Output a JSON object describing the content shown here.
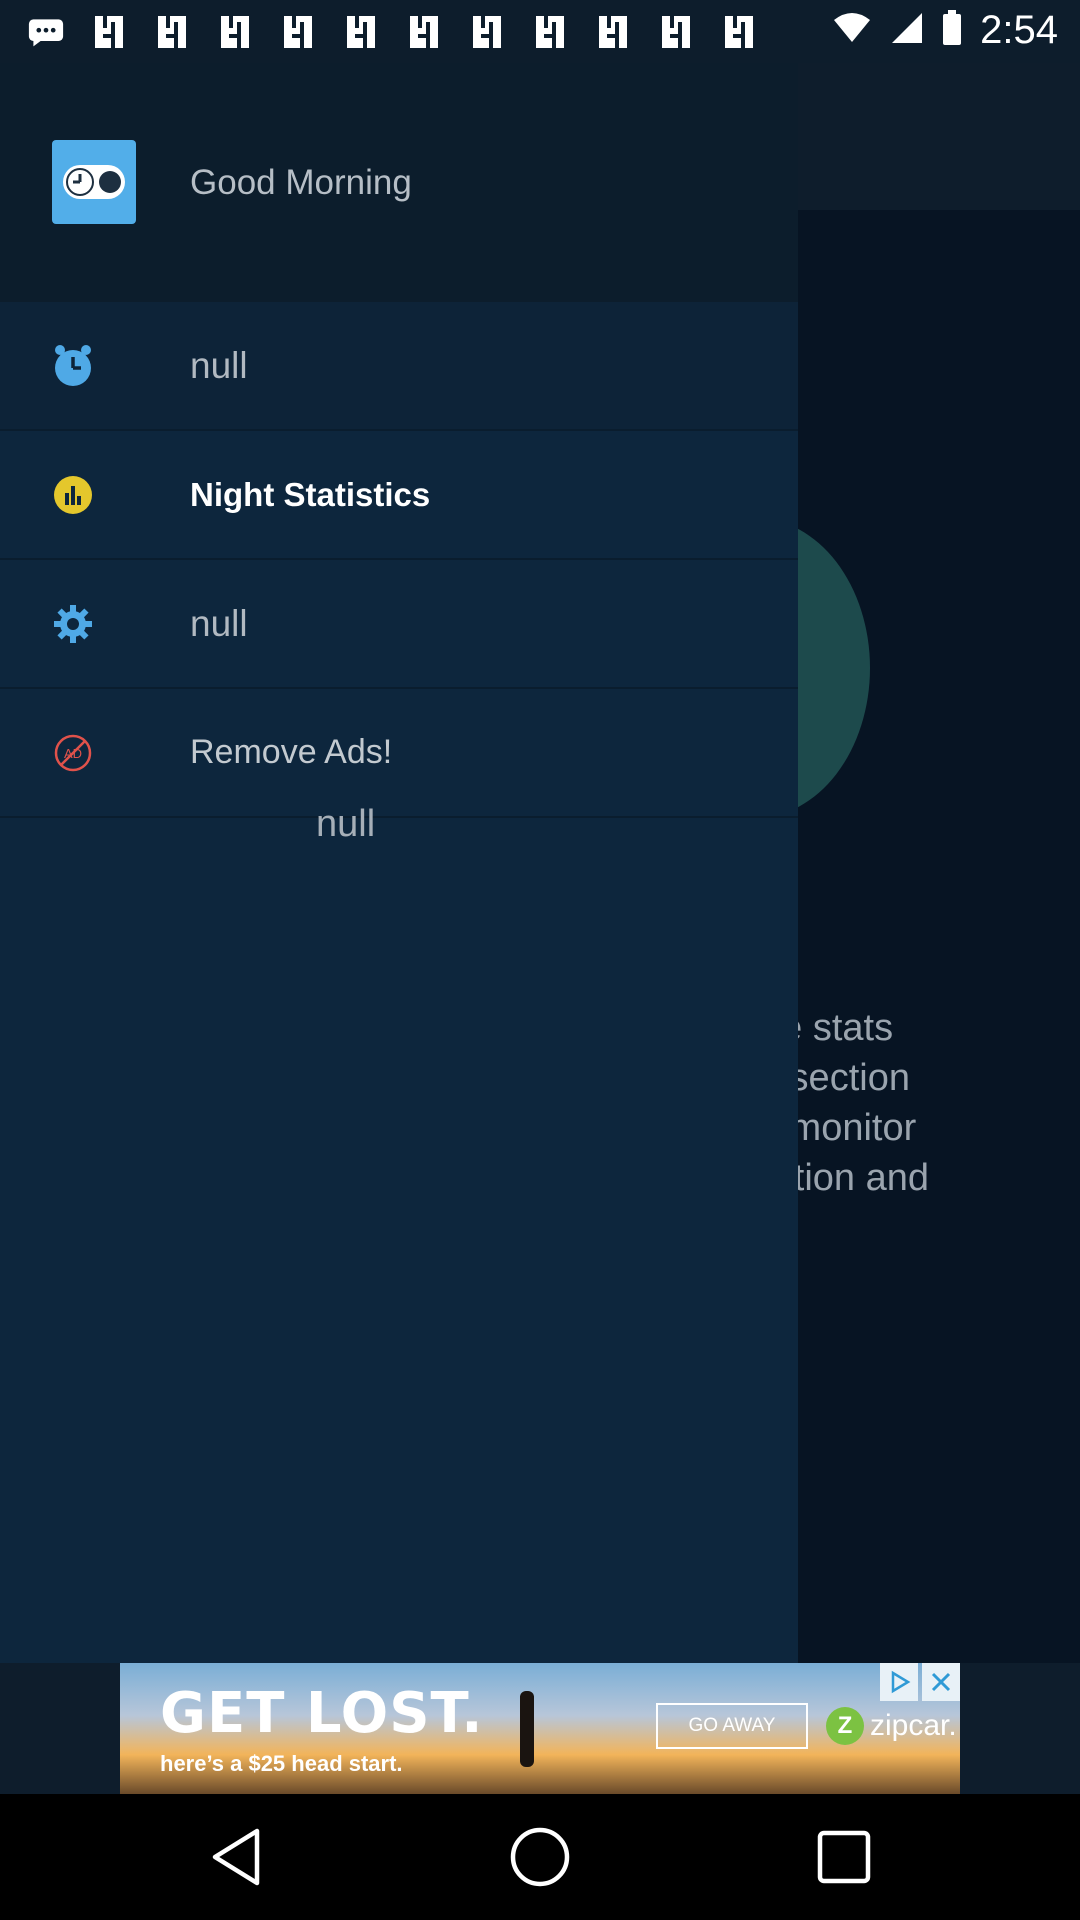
{
  "status_bar": {
    "time": "2:54",
    "icons": [
      "message-icon",
      "notification-icon",
      "notification-icon",
      "notification-icon",
      "notification-icon",
      "notification-icon",
      "notification-icon",
      "notification-icon",
      "notification-icon",
      "notification-icon",
      "notification-icon",
      "notification-icon"
    ]
  },
  "background": {
    "text_lines": [
      "he stats",
      "s section",
      "y monitor",
      "ration and"
    ]
  },
  "drawer": {
    "header_title": "Good Morning",
    "items": [
      {
        "label": "null",
        "icon": "alarm-clock-icon",
        "icon_color": "#4fa9e6"
      },
      {
        "label": "Night Statistics",
        "icon": "bar-chart-icon",
        "icon_color": "#e4c72c"
      },
      {
        "label": "null",
        "icon": "gear-icon",
        "icon_color": "#4fa9e6"
      },
      {
        "label": "Remove Ads!",
        "icon": "no-ads-icon",
        "icon_color": "#e0524b"
      }
    ],
    "footer_text": "null"
  },
  "ad": {
    "headline": "GET LOST.",
    "subtext": "here’s a $25 head start.",
    "cta": "GO AWAY",
    "brand": "zipcar."
  },
  "colors": {
    "accent": "#52aee9",
    "drawer_bg": "#0d263d",
    "header_bg": "#0c1d2c"
  }
}
